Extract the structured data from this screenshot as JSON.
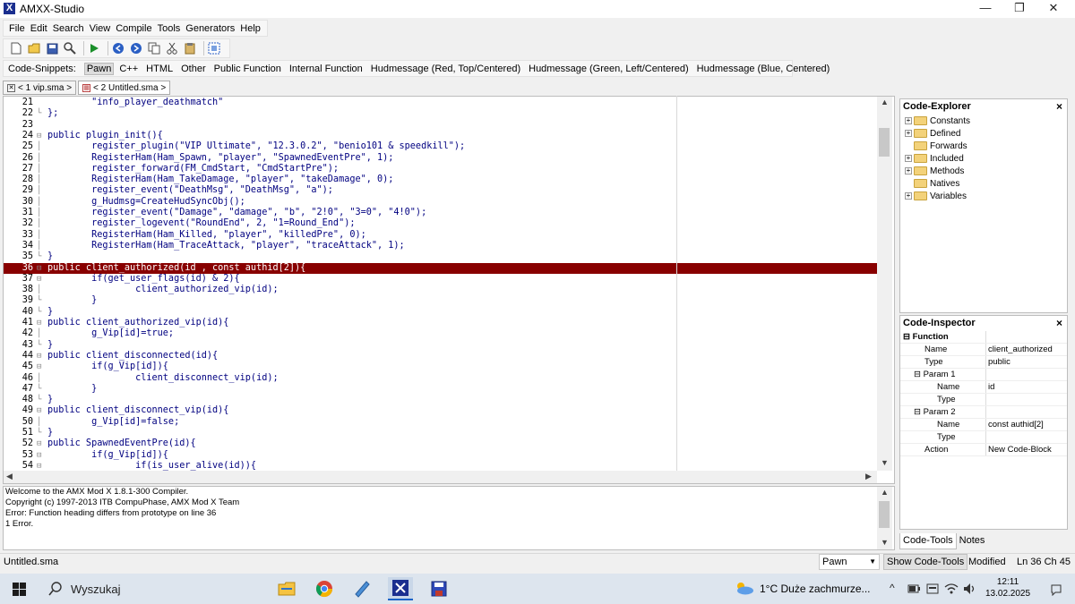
{
  "app": {
    "title": "AMXX-Studio",
    "icon_letter": "X"
  },
  "window_controls": {
    "minimize": "—",
    "maximize": "❐",
    "close": "✕"
  },
  "menu": [
    "File",
    "Edit",
    "Search",
    "View",
    "Compile",
    "Tools",
    "Generators",
    "Help"
  ],
  "toolbar": {
    "icons": [
      "new-file-icon",
      "open-folder-icon",
      "save-icon",
      "find-icon",
      "run-icon",
      "back-icon",
      "forward-icon",
      "copy-icon",
      "cut-icon",
      "paste-icon",
      "select-all-icon"
    ]
  },
  "snippets": {
    "label": "Code-Snippets:",
    "items": [
      "Pawn",
      "C++",
      "HTML",
      "Other",
      "Public Function",
      "Internal Function",
      "Hudmessage (Red, Top/Centered)",
      "Hudmessage (Green, Left/Centered)",
      "Hudmessage (Blue, Centered)"
    ],
    "selected": "Pawn"
  },
  "tabs": [
    {
      "label": "< 1 vip.sma >",
      "active": false
    },
    {
      "label": "< 2 Untitled.sma >",
      "active": true
    }
  ],
  "editor": {
    "highlight_line": "36",
    "lines": [
      {
        "n": "21",
        "fold": "",
        "text": "        \"info_player_deathmatch\""
      },
      {
        "n": "22",
        "fold": "└",
        "text": "};"
      },
      {
        "n": "23",
        "fold": "",
        "text": ""
      },
      {
        "n": "24",
        "fold": "⊟",
        "text": "public plugin_init(){"
      },
      {
        "n": "25",
        "fold": "│",
        "text": "        register_plugin(\"VIP Ultimate\", \"12.3.0.2\", \"benio101 & speedkill\");"
      },
      {
        "n": "26",
        "fold": "│",
        "text": "        RegisterHam(Ham_Spawn, \"player\", \"SpawnedEventPre\", 1);"
      },
      {
        "n": "27",
        "fold": "│",
        "text": "        register_forward(FM_CmdStart, \"CmdStartPre\");"
      },
      {
        "n": "28",
        "fold": "│",
        "text": "        RegisterHam(Ham_TakeDamage, \"player\", \"takeDamage\", 0);"
      },
      {
        "n": "29",
        "fold": "│",
        "text": "        register_event(\"DeathMsg\", \"DeathMsg\", \"a\");"
      },
      {
        "n": "30",
        "fold": "│",
        "text": "        g_Hudmsg=CreateHudSyncObj();"
      },
      {
        "n": "31",
        "fold": "│",
        "text": "        register_event(\"Damage\", \"damage\", \"b\", \"2!0\", \"3=0\", \"4!0\");"
      },
      {
        "n": "32",
        "fold": "│",
        "text": "        register_logevent(\"RoundEnd\", 2, \"1=Round_End\");"
      },
      {
        "n": "33",
        "fold": "│",
        "text": "        RegisterHam(Ham_Killed, \"player\", \"killedPre\", 0);"
      },
      {
        "n": "34",
        "fold": "│",
        "text": "        RegisterHam(Ham_TraceAttack, \"player\", \"traceAttack\", 1);"
      },
      {
        "n": "35",
        "fold": "└",
        "text": "}"
      },
      {
        "n": "36",
        "fold": "⊟",
        "text": "public client_authorized(id , const authid[2]){"
      },
      {
        "n": "37",
        "fold": "⊟",
        "text": "        if(get_user_flags(id) & 2){"
      },
      {
        "n": "38",
        "fold": "│",
        "text": "                client_authorized_vip(id);"
      },
      {
        "n": "39",
        "fold": "└",
        "text": "        }"
      },
      {
        "n": "40",
        "fold": "└",
        "text": "}"
      },
      {
        "n": "41",
        "fold": "⊟",
        "text": "public client_authorized_vip(id){"
      },
      {
        "n": "42",
        "fold": "│",
        "text": "        g_Vip[id]=true;"
      },
      {
        "n": "43",
        "fold": "└",
        "text": "}"
      },
      {
        "n": "44",
        "fold": "⊟",
        "text": "public client_disconnected(id){"
      },
      {
        "n": "45",
        "fold": "⊟",
        "text": "        if(g_Vip[id]){"
      },
      {
        "n": "46",
        "fold": "│",
        "text": "                client_disconnect_vip(id);"
      },
      {
        "n": "47",
        "fold": "└",
        "text": "        }"
      },
      {
        "n": "48",
        "fold": "└",
        "text": "}"
      },
      {
        "n": "49",
        "fold": "⊟",
        "text": "public client_disconnect_vip(id){"
      },
      {
        "n": "50",
        "fold": "│",
        "text": "        g_Vip[id]=false;"
      },
      {
        "n": "51",
        "fold": "└",
        "text": "}"
      },
      {
        "n": "52",
        "fold": "⊟",
        "text": "public SpawnedEventPre(id){"
      },
      {
        "n": "53",
        "fold": "⊟",
        "text": "        if(g_Vip[id]){"
      },
      {
        "n": "54",
        "fold": "⊟",
        "text": "                if(is_user_alive(id)){"
      }
    ]
  },
  "output": [
    "Welcome to the AMX Mod X 1.8.1-300 Compiler.",
    "Copyright (c) 1997-2013 ITB CompuPhase, AMX Mod X Team",
    "",
    "Error: Function heading differs from prototype on line 36",
    "",
    "1 Error."
  ],
  "explorer": {
    "title": "Code-Explorer",
    "close": "×",
    "items": [
      {
        "label": "Constants",
        "expandable": true
      },
      {
        "label": "Defined",
        "expandable": true
      },
      {
        "label": "Forwards",
        "expandable": false
      },
      {
        "label": "Included",
        "expandable": true
      },
      {
        "label": "Methods",
        "expandable": true
      },
      {
        "label": "Natives",
        "expandable": false
      },
      {
        "label": "Variables",
        "expandable": true
      }
    ]
  },
  "inspector": {
    "title": "Code-Inspector",
    "close": "×",
    "rows": [
      {
        "k": "⊟ Function",
        "v": "",
        "indent": 0,
        "bold": true
      },
      {
        "k": "Name",
        "v": "client_authorized",
        "indent": 24,
        "bold": false
      },
      {
        "k": "Type",
        "v": "public",
        "indent": 24,
        "bold": false
      },
      {
        "k": "⊟ Param 1",
        "v": "",
        "indent": 12,
        "bold": false
      },
      {
        "k": "Name",
        "v": "id",
        "indent": 38,
        "bold": false
      },
      {
        "k": "Type",
        "v": "",
        "indent": 38,
        "bold": false
      },
      {
        "k": "⊟ Param 2",
        "v": "",
        "indent": 12,
        "bold": false
      },
      {
        "k": "Name",
        "v": "const authid[2]",
        "indent": 38,
        "bold": false
      },
      {
        "k": "Type",
        "v": "",
        "indent": 38,
        "bold": false
      },
      {
        "k": "Action",
        "v": "New Code-Block",
        "indent": 24,
        "bold": false
      }
    ]
  },
  "right_tabs": {
    "code_tools": "Code-Tools",
    "notes": "Notes"
  },
  "status": {
    "file": "Untitled.sma",
    "language": "Pawn",
    "show_code_tools": "Show Code-Tools",
    "modified": "Modified",
    "position": "Ln 36 Ch 45"
  },
  "taskbar": {
    "search_placeholder": "Wyszukaj",
    "weather": "1°C  Duże zachmurze...",
    "time": "12:11",
    "date": "13.02.2025"
  },
  "colors": {
    "highlight": "#880000",
    "code_text": "#000080"
  }
}
